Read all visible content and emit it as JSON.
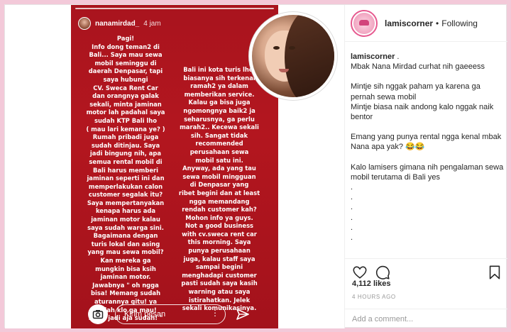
{
  "story": {
    "username": "nanamirdad_",
    "time": "4 jam",
    "left_text": "Pagi!\nInfo dong teman2 di\nBali... Saya mau sewa\nmobil seminggu di\ndaerah Denpasar, tapi\nsaya hubungi\nCV. Sweca Rent Car\ndan orangnya galak\nsekali, minta jaminan\nmotor lah padahal saya\nsudah KTP Bali lho\n( mau lari kemana ye? )\nRumah pribadi juga\nsudah ditinjau. Saya\njadi bingung nih, apa\nsemua rental mobil di\nBali harus memberi\njaminan seperti ini dan\nmemperlakukan calon\ncustomer segalak itu?\nSaya mempertanyakan\nkenapa harus ada\njaminan motor kalau\nsaya sudah warga sini.\nBagaimana dengan\nturis lokal dan asing\nyang mau sewa mobil?\nKan mereka ga\nmungkin bisa ksih\njaminan motor.\nJawabnya \" oh ngga\nbisa! Memang sudah\naturannya gitu! ya\nsudah klo ga mau!\nNgga jadi aja sudah! \"",
    "right_text": "Bali ini kota turis lho,\nbiasanya sih terkenal\nramah2 ya dalam\nmemberikan service.\nKalau ga bisa juga\nngomongnya baik2 ja\nseharusnya, ga perlu\nmarah2.. Kecewa sekali\nsih. Sangat tidak\nrecommended\nperusahaan sewa\nmobil satu ini.\nAnyway, ada yang tau\nsewa mobil mingguan\ndi Denpasar yang\nribet begini dan at least\nngga memandang\nrendah customer kah?\nMohon info ya guys.\nNot a good business\nwith cv.sweca rent car\nthis morning. Saya\npunya perusahaan\njuga, kalau staff saya\nsampai begini\nmenghadapi customer\npasti sudah saya kasih\nwarning atau saya\nistirahatkan. Jelek\nsekali komunikasinya.",
    "reply_placeholder": "Kirim pesan",
    "reply_more": "⋮"
  },
  "post": {
    "account": "lamiscorner",
    "separator": "•",
    "follow_status": "Following",
    "caption_user": "lamiscorner",
    "caption_user_suffix": " .",
    "caption_lines": [
      "Mbak Nana Mirdad curhat nih gaeeess",
      "",
      "Mintje sih nggak paham ya karena ga pernah sewa mobil",
      "Mintje biasa naik andong kalo nggak naik bentor",
      "",
      "Emang yang punya rental ngga kenal mbak Nana apa yak? 😂😂",
      "",
      "Kalo lamisers gimana nih pengalaman sewa mobil terutama di Bali yes",
      ".",
      ".",
      ".",
      ".",
      ".",
      "."
    ],
    "likes": "4,112 likes",
    "time_ago": "4 HOURS AGO",
    "comment_placeholder": "Add a comment..."
  },
  "icons": [
    "camera-icon",
    "send-icon",
    "heart-icon",
    "comment-icon",
    "bookmark-icon"
  ],
  "colors": {
    "story_red": "#b3161f",
    "page_bg": "#f3c9d9",
    "brand_pink": "#e6598f"
  }
}
